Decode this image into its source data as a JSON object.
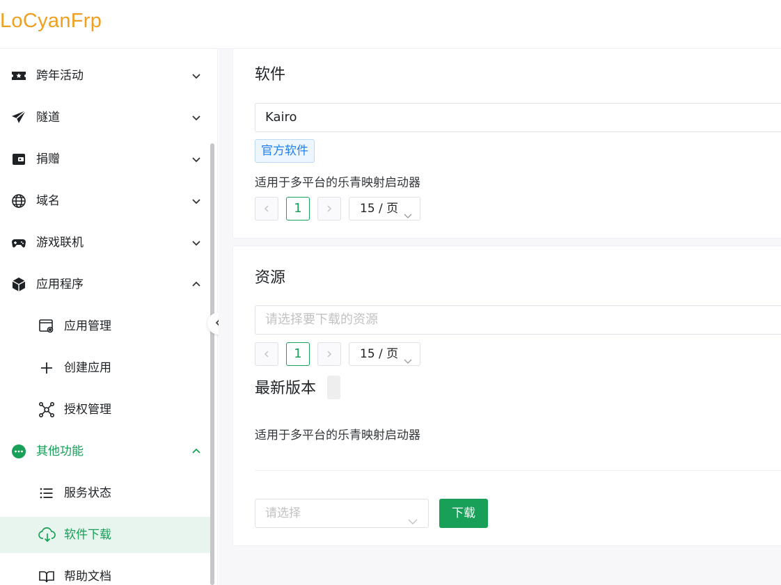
{
  "app": {
    "logo": "LoCyanFrp"
  },
  "sidebar": {
    "items": [
      {
        "label": "跨年活动",
        "icon": "ticket-star-icon",
        "expanded": false
      },
      {
        "label": "隧道",
        "icon": "paper-plane-icon",
        "expanded": false
      },
      {
        "label": "捐赠",
        "icon": "wallet-icon",
        "expanded": false
      },
      {
        "label": "域名",
        "icon": "globe-icon",
        "expanded": false
      },
      {
        "label": "游戏联机",
        "icon": "gamepad-icon",
        "expanded": false
      },
      {
        "label": "应用程序",
        "icon": "package-box-icon",
        "expanded": true,
        "children": [
          {
            "label": "应用管理",
            "icon": "app-settings-icon"
          },
          {
            "label": "创建应用",
            "icon": "plus-icon"
          },
          {
            "label": "授权管理",
            "icon": "network-nodes-icon"
          }
        ]
      },
      {
        "label": "其他功能",
        "icon": "more-circle-icon",
        "expanded": true,
        "active": true,
        "children": [
          {
            "label": "服务状态",
            "icon": "list-icon"
          },
          {
            "label": "软件下载",
            "icon": "cloud-download-icon",
            "active": true
          },
          {
            "label": "帮助文档",
            "icon": "book-open-icon"
          }
        ]
      }
    ]
  },
  "software_card": {
    "title": "软件",
    "selected_value": "Kairo",
    "tag": "官方软件",
    "description": "适用于多平台的乐青映射启动器",
    "pager": {
      "current_page": "1",
      "page_size": "15 / 页"
    }
  },
  "resource_card": {
    "title": "资源",
    "search_placeholder": "请选择要下载的资源",
    "pager": {
      "current_page": "1",
      "page_size": "15 / 页"
    },
    "latest_title": "最新版本",
    "description": "适用于多平台的乐青映射启动器",
    "select_placeholder": "请选择",
    "download_label": "下载"
  },
  "colors": {
    "accent": "#18a058",
    "accent_bg": "#e7f5ee",
    "logo": "#f0a020",
    "tag_blue": "#2080f0"
  }
}
